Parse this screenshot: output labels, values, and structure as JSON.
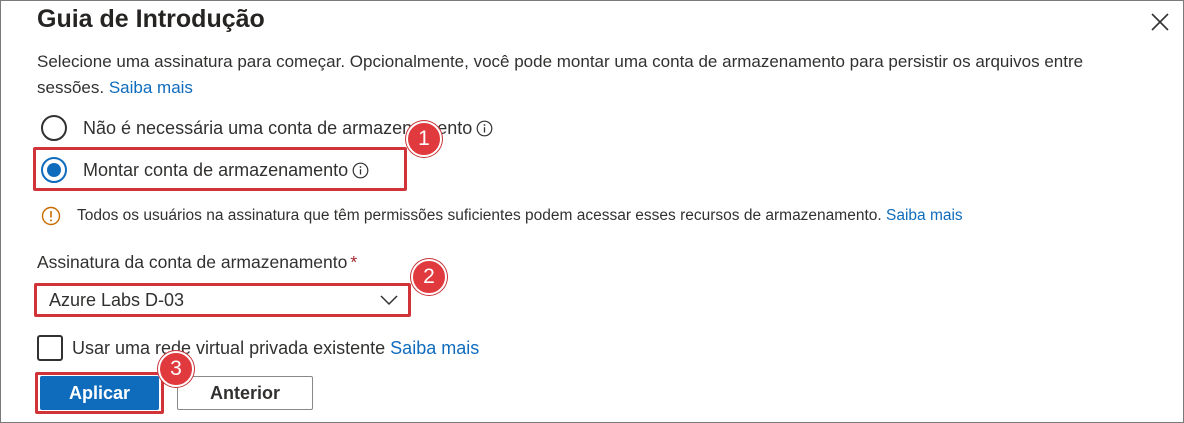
{
  "dialog": {
    "title": "Guia de Introdução",
    "description_prefix": "Selecione uma assinatura para começar. Opcionalmente, você pode montar uma conta de armazenamento para persistir os arquivos entre sessões.",
    "description_link": "Saiba mais"
  },
  "storage_options": [
    {
      "label": "Não é necessária uma conta de armazenamento",
      "selected": false,
      "icon": "info-icon"
    },
    {
      "label": "Montar conta de armazenamento",
      "selected": true,
      "icon": "info-icon"
    }
  ],
  "warning": {
    "icon": "warning-info-icon",
    "text": "Todos os usuários na assinatura que têm permissões suficientes podem acessar esses recursos de armazenamento.",
    "link": "Saiba mais"
  },
  "subscription_field": {
    "label": "Assinatura da conta de armazenamento",
    "required_marker": "*",
    "value": "Azure Labs D-03"
  },
  "vnet_checkbox": {
    "label": "Usar uma rede virtual privada existente",
    "link": "Saiba mais",
    "checked": false
  },
  "buttons": {
    "apply": "Aplicar",
    "previous": "Anterior"
  },
  "callouts": [
    "1",
    "2",
    "3"
  ],
  "colors": {
    "accent": "#0f6cbd",
    "callout": "#e0393e",
    "highlight_border": "#d13438",
    "warning_icon": "#c86c00"
  }
}
